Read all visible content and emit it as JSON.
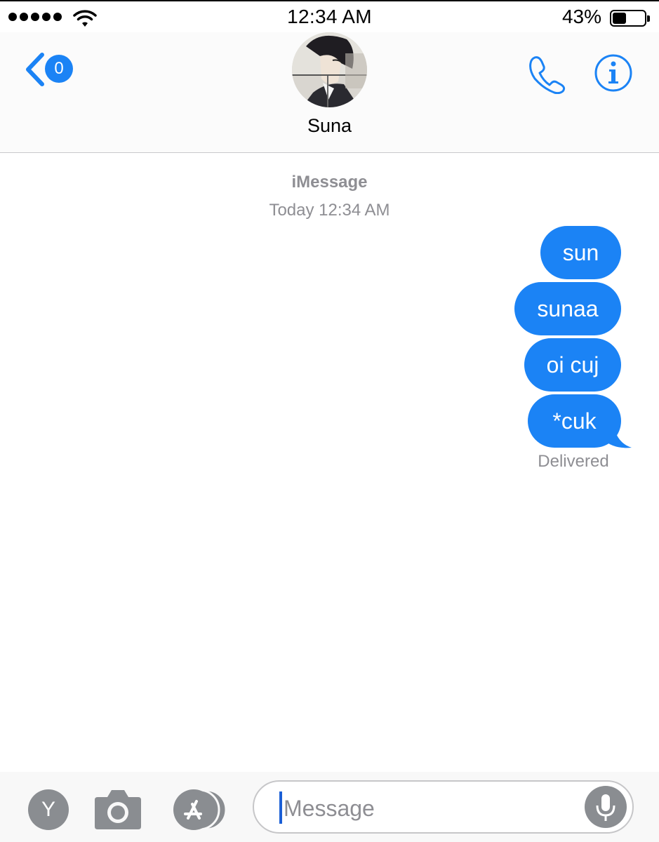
{
  "status_bar": {
    "signal_icon": "signal-dots-icon",
    "wifi_icon": "wifi-icon",
    "time": "12:34 AM",
    "battery_percent": "43%",
    "battery_level": 0.43
  },
  "header": {
    "back_badge": "0",
    "contact_name": "Suna",
    "call_icon": "phone-icon",
    "info_icon": "info-icon",
    "accent_color": "#1b83f5"
  },
  "conversation": {
    "service": "iMessage",
    "timestamp": "Today 12:34 AM",
    "messages": [
      {
        "text": "sun",
        "sender": "me"
      },
      {
        "text": "sunaa",
        "sender": "me"
      },
      {
        "text": "oi cuj",
        "sender": "me"
      },
      {
        "text": "*cuk",
        "sender": "me"
      }
    ],
    "status": "Delivered"
  },
  "input_bar": {
    "apps_letter": "Y",
    "camera_icon": "camera-icon",
    "appstore_icon": "app-store-icon",
    "placeholder": "Message",
    "mic_icon": "microphone-icon"
  }
}
